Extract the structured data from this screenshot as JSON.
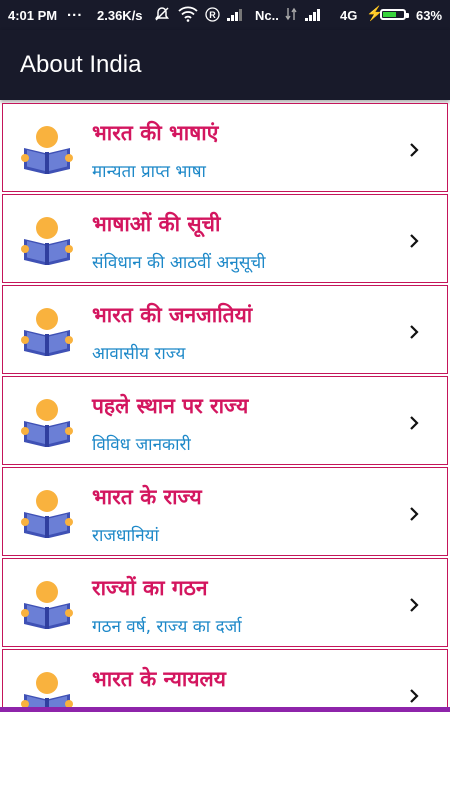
{
  "status_bar": {
    "time": "4:01 PM",
    "dots": "...",
    "speed": "2.36K/s",
    "r_badge": "R",
    "carrier": "Nc..",
    "network": "4G",
    "bolt": "⚡",
    "battery_percent": "63%",
    "battery_level": 0.63,
    "battery_color": "#38d33c"
  },
  "app_bar": {
    "title": "About India"
  },
  "list": {
    "items": [
      {
        "title": "भारत की भाषाएं",
        "subtitle": "मान्यता प्राप्त भाषा"
      },
      {
        "title": "भाषाओं की सूची",
        "subtitle": "संविधान की आठवीं अनुसूची"
      },
      {
        "title": "भारत की जनजातियां",
        "subtitle": "आवासीय राज्य"
      },
      {
        "title": "पहले स्थान पर राज्य",
        "subtitle": "विविध जानकारी"
      },
      {
        "title": "भारत के राज्य",
        "subtitle": "राजधानियां"
      },
      {
        "title": "राज्यों का गठन",
        "subtitle": "गठन वर्ष, राज्य का दर्जा"
      },
      {
        "title": "भारत के न्यायलय",
        "subtitle": ""
      }
    ]
  },
  "colors": {
    "app_bar": "#181a2a",
    "title_text": "#d3165f",
    "subtitle_text": "#1d88c8",
    "row_border": "#c4155a",
    "bottom_bar": "#8e24aa"
  },
  "icons": {
    "row_avatar": "reading-person-icon",
    "row_chevron": "chevron-right-icon"
  }
}
